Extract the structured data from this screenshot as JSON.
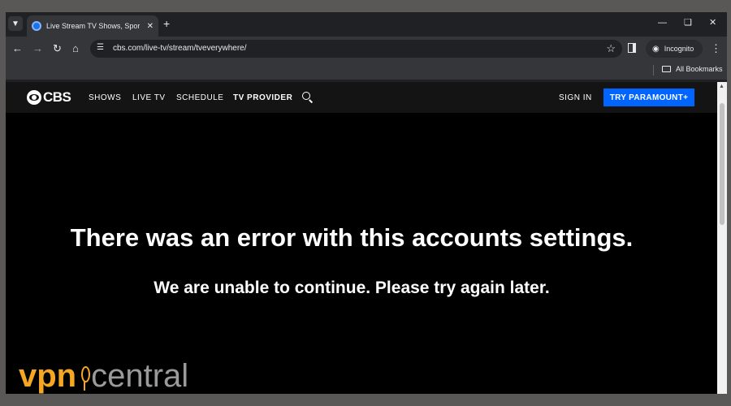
{
  "browser": {
    "tab": {
      "title": "Live Stream TV Shows, Sports a"
    },
    "address_bar": {
      "url": "cbs.com/live-tv/stream/tveverywhere/"
    },
    "profile": {
      "label": "Incognito"
    },
    "bookmarks": {
      "folder_label": "All Bookmarks"
    },
    "icons": {
      "tab_search": "chevron-down-icon",
      "tab_close": "close-icon",
      "new_tab": "plus-icon",
      "back": "back-arrow-icon",
      "forward": "forward-arrow-icon",
      "reload": "reload-icon",
      "home": "home-icon",
      "site_info": "tune-icon",
      "bookmark": "star-icon",
      "side_panel": "side-panel-icon",
      "incognito": "incognito-icon",
      "menu": "more-vertical-icon",
      "folder": "folder-icon"
    }
  },
  "site": {
    "logo_text": "CBS",
    "nav": [
      "SHOWS",
      "LIVE TV",
      "SCHEDULE",
      "TV PROVIDER"
    ],
    "sign_in": "SIGN IN",
    "cta": "TRY PARAMOUNT+",
    "accent_color": "#0064ff"
  },
  "error": {
    "title": "There was an error with this accounts settings.",
    "message": "We are unable to continue. Please try again later."
  },
  "watermark": {
    "left": "vpn",
    "right": "central",
    "color": "#f5a623"
  }
}
